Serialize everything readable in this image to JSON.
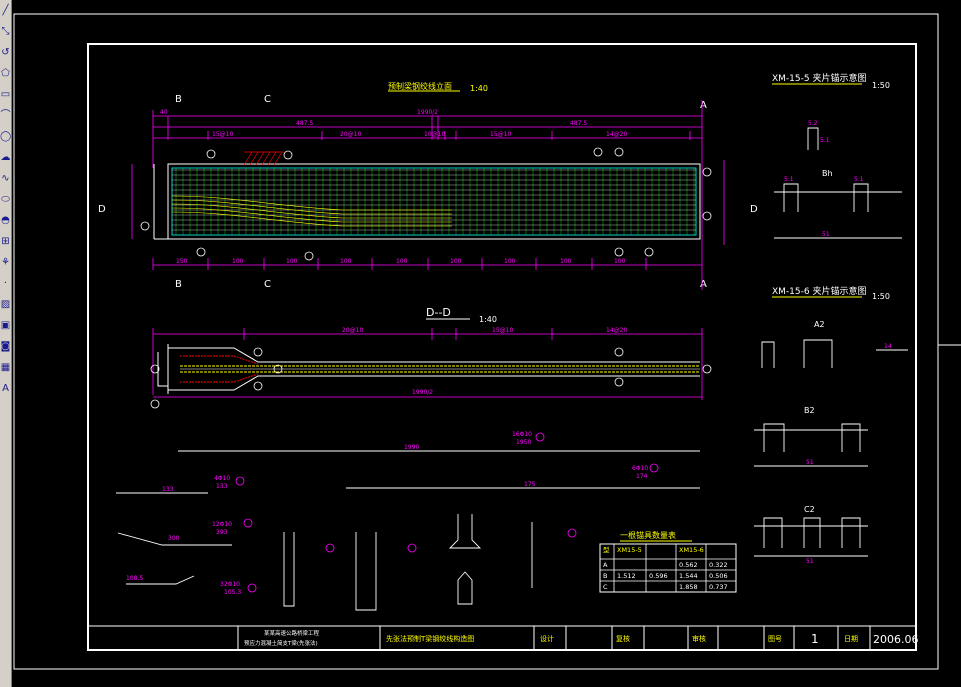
{
  "toolbar": {
    "tools": [
      {
        "name": "line-icon",
        "glyph": "╱"
      },
      {
        "name": "construction-line-icon",
        "glyph": "⤡"
      },
      {
        "name": "polyline-icon",
        "glyph": "↺"
      },
      {
        "name": "polygon-icon",
        "glyph": "⬠"
      },
      {
        "name": "rectangle-icon",
        "glyph": "▭"
      },
      {
        "name": "arc-icon",
        "glyph": "⌒"
      },
      {
        "name": "circle-icon",
        "glyph": "◯"
      },
      {
        "name": "revision-cloud-icon",
        "glyph": "☁"
      },
      {
        "name": "spline-icon",
        "glyph": "∿"
      },
      {
        "name": "ellipse-icon",
        "glyph": "⬭"
      },
      {
        "name": "ellipse-arc-icon",
        "glyph": "◓"
      },
      {
        "name": "insert-block-icon",
        "glyph": "⊞"
      },
      {
        "name": "make-block-icon",
        "glyph": "⚘"
      },
      {
        "name": "point-icon",
        "glyph": "·"
      },
      {
        "name": "hatch-icon",
        "glyph": "▨"
      },
      {
        "name": "gradient-icon",
        "glyph": "▣"
      },
      {
        "name": "region-icon",
        "glyph": "◙"
      },
      {
        "name": "table-icon",
        "glyph": "▦"
      },
      {
        "name": "multiline-text-icon",
        "glyph": "A"
      }
    ]
  },
  "drawing": {
    "main_title": "预制梁钢绞线立面",
    "main_scale": "1:40",
    "section_label": "D--D",
    "section_scale": "1:40",
    "section_marks": {
      "b": "B",
      "c": "C",
      "a": "A",
      "d": "D"
    },
    "top_dims": [
      "40",
      "487.5",
      "487.5"
    ],
    "overall_dim": "1990/2",
    "spacing_dims": [
      "15@10",
      "20@10",
      "10@10",
      "15@10",
      "14@20"
    ],
    "bottom_dims": [
      "150",
      "100",
      "100",
      "100",
      "100",
      "100",
      "100",
      "100",
      "100"
    ],
    "section_dims": [
      "20@10",
      "15@10",
      "14@20"
    ],
    "section_overall": "1990/2",
    "bar_labels": {
      "bar1": {
        "length": "1990",
        "spec": "16Φ10",
        "len2": "1950"
      },
      "bar2": {
        "length": "175",
        "spec": "6Φ10",
        "len2": "174"
      },
      "bar3": {
        "length": "133",
        "spec": "4Φ10",
        "len2": "133"
      },
      "bar4": {
        "length": "300",
        "spec": "12Φ10",
        "len2": "393"
      },
      "bar5": {
        "length": "108.5",
        "spec": "32Φ10",
        "len2": "105.3"
      }
    },
    "anchor_detail_1": {
      "title": "XM-15-5 夹片锚示意图",
      "scale": "1:50",
      "labels": [
        "5.1",
        "5.2",
        "5.1",
        "5.1",
        "Bh",
        "51"
      ]
    },
    "anchor_detail_2": {
      "title": "XM-15-6 夹片锚示意图",
      "scale": "1:50",
      "labels": [
        "A2",
        "B2",
        "C2",
        "14",
        "51",
        "51",
        "51"
      ]
    },
    "anchor_table": {
      "title": "一根锚具数量表",
      "headers": [
        "型",
        "XM15-5",
        "",
        "XM15-6",
        ""
      ],
      "rows": [
        [
          "A",
          "",
          "",
          "0.562",
          "0.322"
        ],
        [
          "B",
          "1.512",
          "0.596",
          "1.544",
          "0.506"
        ],
        [
          "C",
          "",
          "",
          "1.858",
          "0.737"
        ]
      ]
    },
    "title_block": {
      "project_line1": "某某高速公路桥梁工程",
      "project_line2": "预应力混凝土简支T梁(先张法)",
      "drawing_name": "先张法预制T梁钢绞线构造图",
      "design_label": "设计",
      "review_label": "复核",
      "approve_label": "审核",
      "sheet_label": "图号",
      "sheet_no": "1",
      "date_label": "日期",
      "date": "2006.06"
    }
  },
  "colors": {
    "background": "#000000",
    "frame": "#ffffff",
    "dimension": "#ff00ff",
    "rebar": "#ffff00",
    "mesh": "#00ff00",
    "strand": "#ffffff",
    "cyan": "#00ffff",
    "hatch": "#ff0000",
    "text_yellow": "#ffff00",
    "text_green": "#00ff00"
  }
}
